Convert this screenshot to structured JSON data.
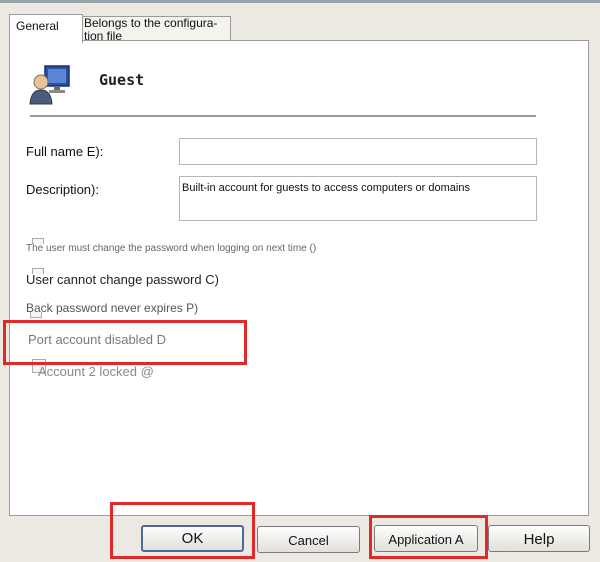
{
  "tabs": {
    "general_label": "General",
    "config_label": "Belongs to the configura- tion file"
  },
  "user": {
    "name": "Guest",
    "icon": "user-account-icon"
  },
  "form": {
    "full_name_label": "Full name E):",
    "full_name_value": "",
    "description_label": "Description):",
    "description_value": "Built-in account for guests to access computers or domains"
  },
  "options": {
    "must_change_password": "The user must change the password when logging on next time ()",
    "cannot_change_password": "User cannot change password C)",
    "password_never_expires": "Back password never expires P)",
    "account_disabled": "Port account disabled D",
    "account_locked": "Account 2 locked @"
  },
  "buttons": {
    "ok": "OK",
    "cancel": "Cancel",
    "apply": "Application A",
    "help": "Help"
  },
  "colors": {
    "highlight": "#e02a2a",
    "dialog_bg": "#ece9e2"
  }
}
